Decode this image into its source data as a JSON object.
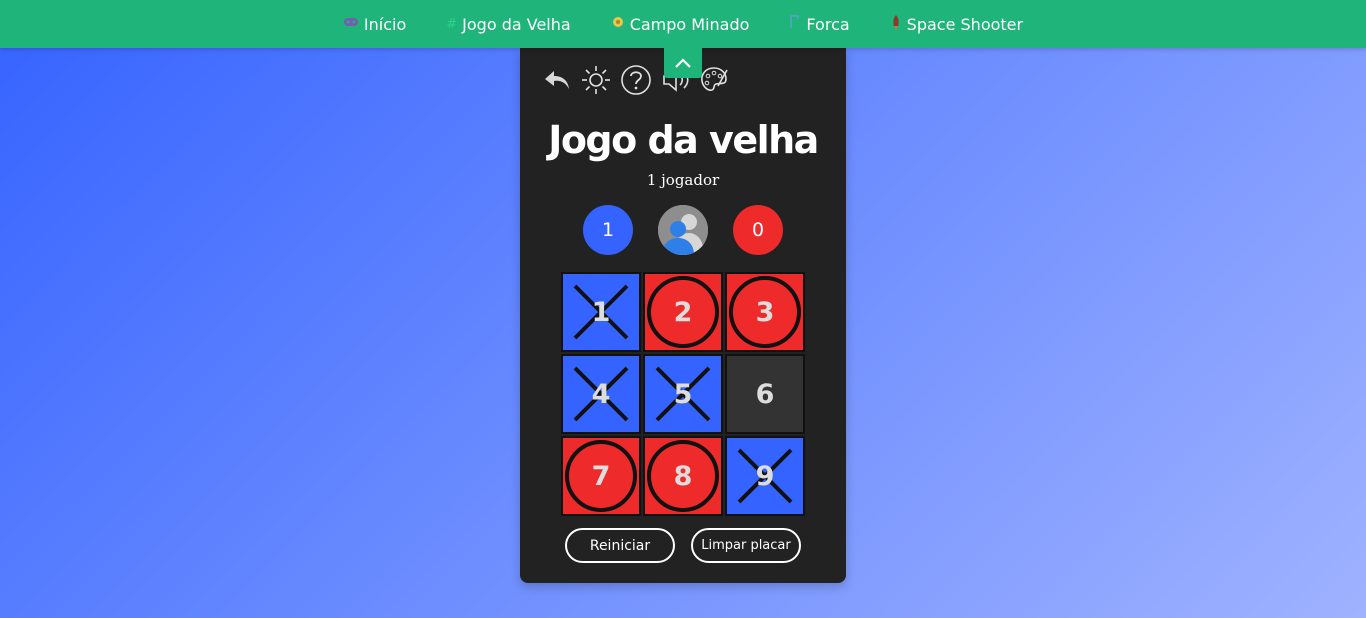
{
  "nav": {
    "items": [
      {
        "label": "Início",
        "icon": "gamepad-icon"
      },
      {
        "label": "Jogo da Velha",
        "icon": "hash-icon"
      },
      {
        "label": "Campo Minado",
        "icon": "mine-icon"
      },
      {
        "label": "Forca",
        "icon": "hangman-icon"
      },
      {
        "label": "Space Shooter",
        "icon": "rocket-icon"
      }
    ],
    "background": "#1fb47a"
  },
  "toolbar": {
    "icons": [
      "undo-icon",
      "sun-icon",
      "help-icon",
      "speaker-icon",
      "palette-icon"
    ]
  },
  "game": {
    "title": "Jogo da velha",
    "mode": "1 jogador",
    "score_x": "1",
    "score_o": "0",
    "board": [
      {
        "num": "1",
        "mark": "x"
      },
      {
        "num": "2",
        "mark": "o"
      },
      {
        "num": "3",
        "mark": "o"
      },
      {
        "num": "4",
        "mark": "x"
      },
      {
        "num": "5",
        "mark": "x"
      },
      {
        "num": "6",
        "mark": ""
      },
      {
        "num": "7",
        "mark": "o"
      },
      {
        "num": "8",
        "mark": "o"
      },
      {
        "num": "9",
        "mark": "x"
      }
    ]
  },
  "buttons": {
    "restart": "Reiniciar",
    "clear_score": "Limpar placar"
  },
  "colors": {
    "x_color": "#3563ff",
    "o_color": "#ee2a2a",
    "panel": "#222222"
  }
}
